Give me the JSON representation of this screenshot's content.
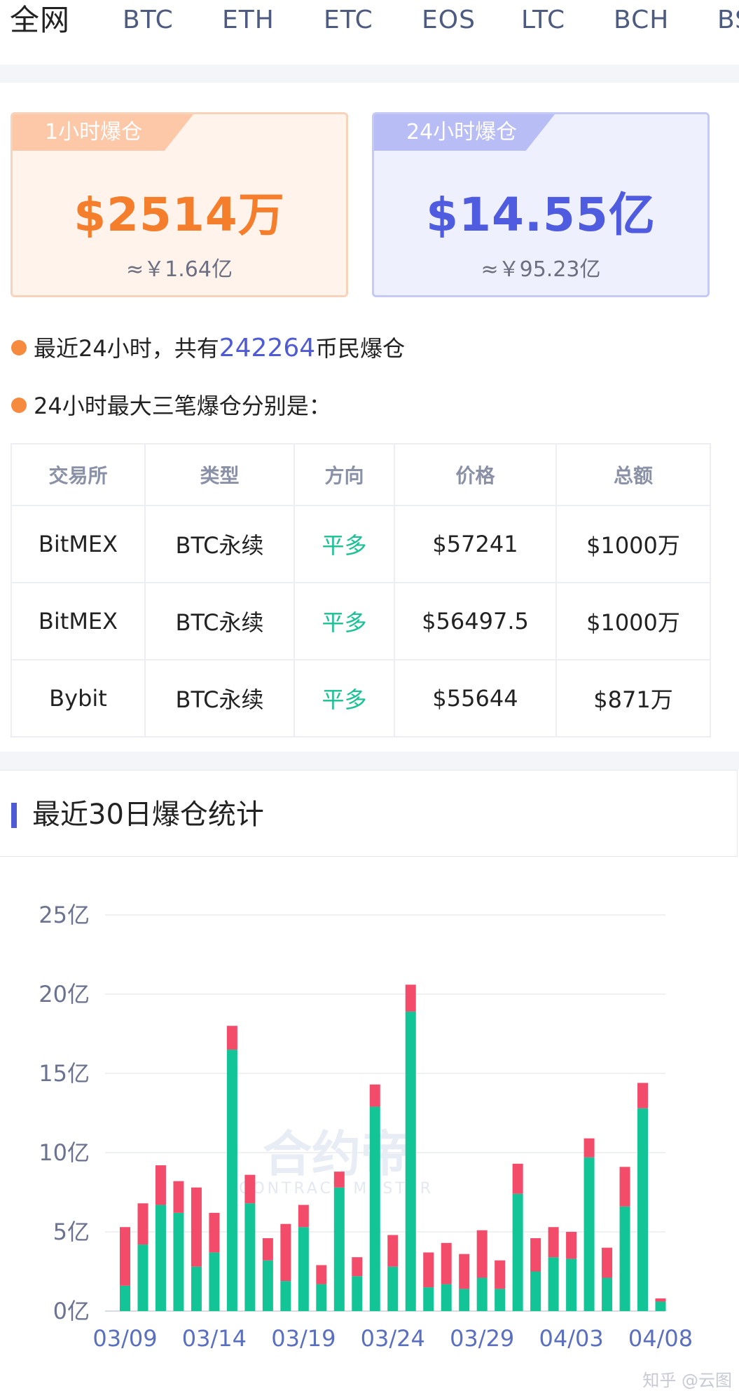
{
  "tabs": [
    {
      "label": "全网",
      "active": true
    },
    {
      "label": "BTC"
    },
    {
      "label": "ETH"
    },
    {
      "label": "ETC"
    },
    {
      "label": "EOS"
    },
    {
      "label": "LTC"
    },
    {
      "label": "BCH"
    },
    {
      "label": "BS"
    }
  ],
  "cards": {
    "hour": {
      "label": "1小时爆仓",
      "amount": "$2514万",
      "cny": "≈￥1.64亿",
      "color": "#f47e2c"
    },
    "day": {
      "label": "24小时爆仓",
      "amount": "$14.55亿",
      "cny": "≈￥95.23亿",
      "color": "#505ce0"
    }
  },
  "stats": {
    "people_prefix": "最近24小时，共有",
    "people_count": "242264",
    "people_suffix": "币民爆仓",
    "top3_label": "24小时最大三笔爆仓分别是："
  },
  "table": {
    "headers": [
      "交易所",
      "类型",
      "方向",
      "价格",
      "总额"
    ],
    "rows": [
      [
        "BitMEX",
        "BTC永续",
        "平多",
        "$57241",
        "$1000万"
      ],
      [
        "BitMEX",
        "BTC永续",
        "平多",
        "$56497.5",
        "$1000万"
      ],
      [
        "Bybit",
        "BTC永续",
        "平多",
        "$55644",
        "$871万"
      ]
    ],
    "direction_color": "#19c195"
  },
  "section": {
    "title": "最近30日爆仓统计"
  },
  "chart_data": {
    "type": "bar",
    "stacked": true,
    "ylim": [
      0,
      25
    ],
    "yticks": [
      "0亿",
      "5亿",
      "10亿",
      "15亿",
      "20亿",
      "25亿"
    ],
    "x_tick_labels": [
      "03/09",
      "03/14",
      "03/19",
      "03/24",
      "03/29",
      "04/03",
      "04/08"
    ],
    "categories": [
      "03/09",
      "03/10",
      "03/11",
      "03/12",
      "03/13",
      "03/14",
      "03/15",
      "03/16",
      "03/17",
      "03/18",
      "03/19",
      "03/20",
      "03/21",
      "03/22",
      "03/23",
      "03/24",
      "03/25",
      "03/26",
      "03/27",
      "03/28",
      "03/29",
      "03/30",
      "03/31",
      "04/01",
      "04/02",
      "04/03",
      "04/04",
      "04/05",
      "04/06",
      "04/07",
      "04/08"
    ],
    "series": [
      {
        "color": "#12c496",
        "values": [
          1.6,
          4.2,
          6.7,
          6.2,
          2.8,
          3.7,
          16.5,
          6.8,
          3.2,
          1.9,
          5.3,
          1.7,
          7.8,
          2.2,
          12.9,
          2.8,
          18.9,
          1.5,
          1.7,
          1.4,
          2.1,
          1.4,
          7.4,
          2.5,
          3.4,
          3.3,
          9.7,
          2.1,
          6.6,
          12.8,
          0.6
        ]
      },
      {
        "color": "#f24c6a",
        "values": [
          3.7,
          2.6,
          2.5,
          2.0,
          5.0,
          2.5,
          1.5,
          1.8,
          1.4,
          3.6,
          1.4,
          1.2,
          1.0,
          1.2,
          1.4,
          2.0,
          1.7,
          2.2,
          2.6,
          2.2,
          3.0,
          1.8,
          1.9,
          2.1,
          1.9,
          1.7,
          1.2,
          1.9,
          2.5,
          1.6,
          0.2
        ]
      }
    ],
    "watermark": "合约帝",
    "watermark_sub": "CONTRACT MASTER"
  },
  "footer": {
    "mark": "知乎 @云图"
  }
}
